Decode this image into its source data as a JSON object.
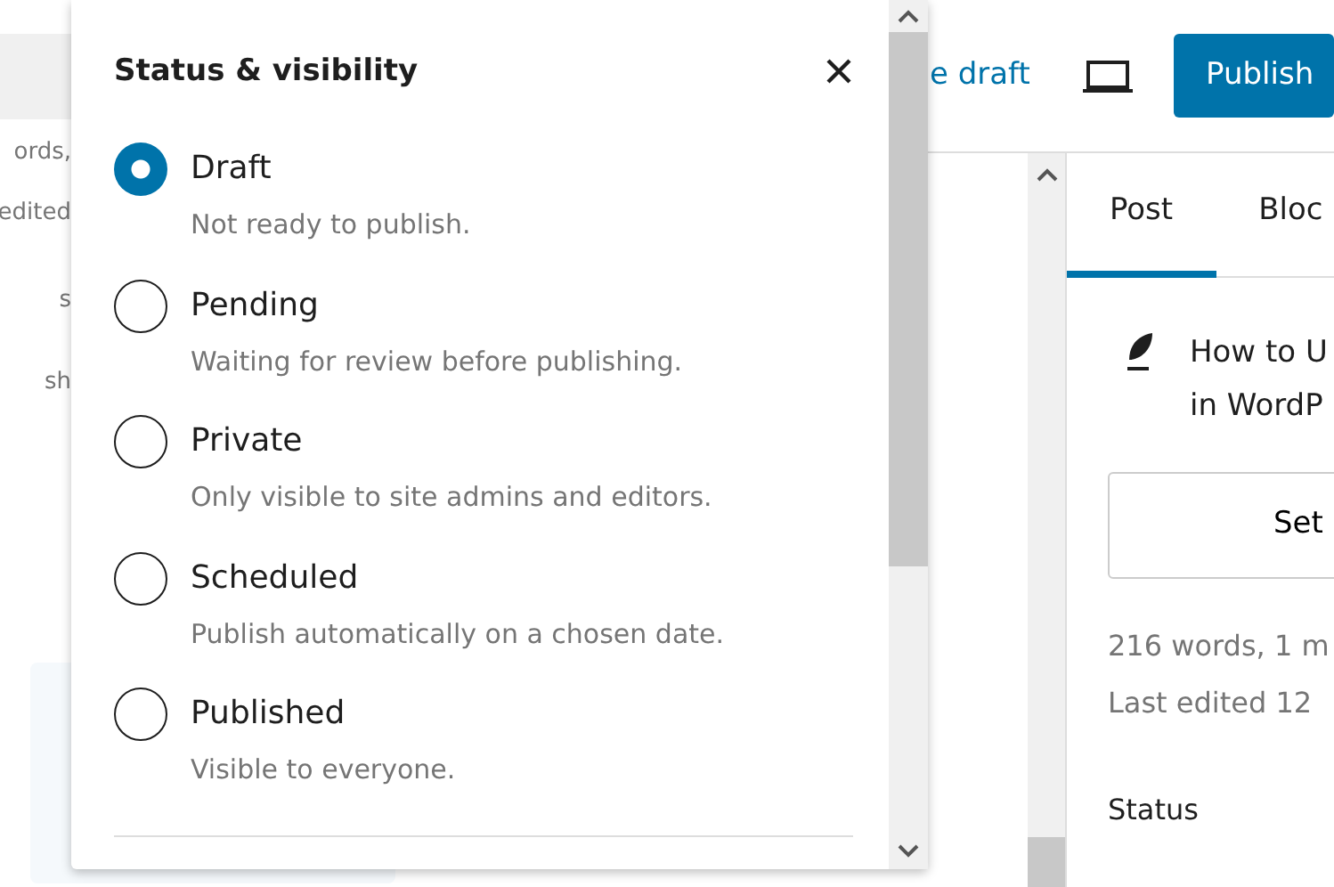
{
  "header": {
    "save_link": "e draft",
    "publish_button": "Publish"
  },
  "background_fragments": [
    "ords,",
    "edited",
    "s",
    "sh"
  ],
  "popover": {
    "title": "Status & visibility",
    "options": [
      {
        "label": "Draft",
        "description": "Not ready to publish.",
        "selected": true
      },
      {
        "label": "Pending",
        "description": "Waiting for review before publishing.",
        "selected": false
      },
      {
        "label": "Private",
        "description": "Only visible to site admins and editors.",
        "selected": false
      },
      {
        "label": "Scheduled",
        "description": "Publish automatically on a chosen date.",
        "selected": false
      },
      {
        "label": "Published",
        "description": "Visible to everyone.",
        "selected": false
      }
    ]
  },
  "sidebar": {
    "tabs": [
      {
        "label": "Post",
        "selected": true
      },
      {
        "label": "Bloc",
        "selected": false
      }
    ],
    "post_title_lines": [
      "How to U",
      "in WordP"
    ],
    "set_button": "Set",
    "stats": [
      "216 words, 1 m",
      "Last edited 12"
    ],
    "status_label": "Status"
  }
}
